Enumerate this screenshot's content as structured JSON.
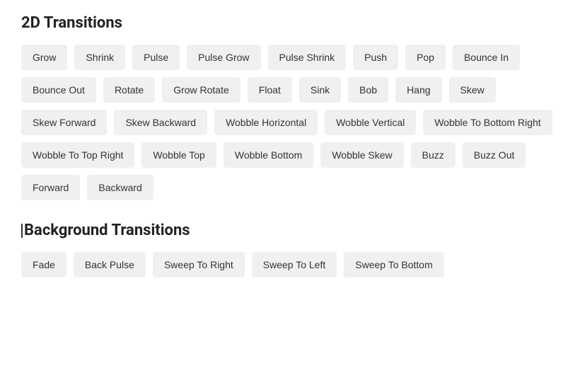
{
  "sections": [
    {
      "id": "2d-transitions",
      "title": "2D Transitions",
      "buttons": [
        "Grow",
        "Shrink",
        "Pulse",
        "Pulse Grow",
        "Pulse Shrink",
        "Push",
        "Pop",
        "Bounce In",
        "Bounce Out",
        "Rotate",
        "Grow Rotate",
        "Float",
        "Sink",
        "Bob",
        "Hang",
        "Skew",
        "Skew Forward",
        "Skew Backward",
        "Wobble Horizontal",
        "Wobble Vertical",
        "Wobble To Bottom Right",
        "Wobble To Top Right",
        "Wobble Top",
        "Wobble Bottom",
        "Wobble Skew",
        "Buzz",
        "Buzz Out",
        "Forward",
        "Backward"
      ]
    },
    {
      "id": "background-transitions",
      "title": "Background Transitions",
      "buttons": [
        "Fade",
        "Back Pulse",
        "Sweep To Right",
        "Sweep To Left",
        "Sweep To Bottom"
      ]
    }
  ]
}
